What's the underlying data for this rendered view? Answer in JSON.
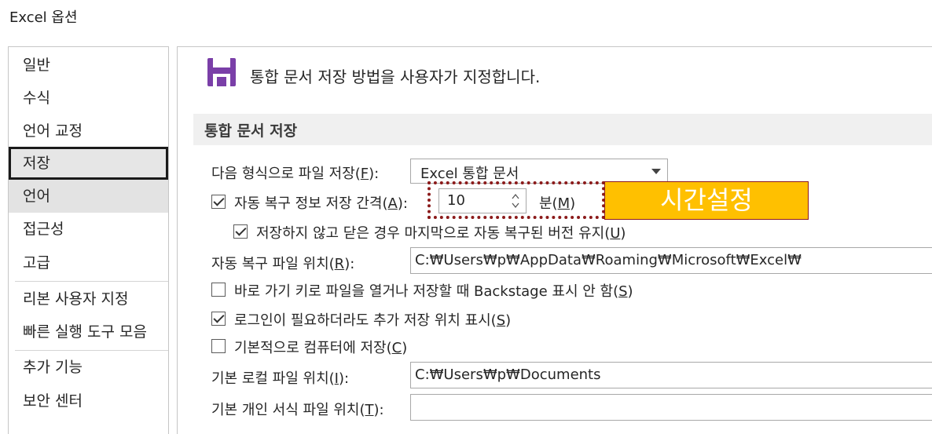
{
  "window": {
    "title": "Excel 옵션"
  },
  "nav": {
    "items": [
      {
        "label": "일반"
      },
      {
        "label": "수식"
      },
      {
        "label": "언어 교정"
      },
      {
        "label": "저장"
      },
      {
        "label": "언어"
      },
      {
        "label": "접근성"
      },
      {
        "label": "고급"
      },
      {
        "label": "리본 사용자 지정"
      },
      {
        "label": "빠른 실행 도구 모음"
      },
      {
        "label": "추가 기능"
      },
      {
        "label": "보안 센터"
      }
    ],
    "selected": "저장"
  },
  "main": {
    "header": "통합 문서 저장 방법을 사용자가 지정합니다.",
    "header_icon": "save-icon",
    "section_title": "통합 문서 저장",
    "save_format": {
      "label": "다음 형식으로 파일 저장(",
      "key": "F",
      "suffix": "):",
      "value": "Excel 통합 문서"
    },
    "autorecover": {
      "label": "자동 복구 정보 저장 간격(",
      "key": "A",
      "suffix": "):",
      "checked": true,
      "value": "10",
      "unit_label": "분(",
      "unit_key": "M",
      "unit_suffix": ")"
    },
    "keep_last": {
      "label": "저장하지 않고 닫은 경우 마지막으로 자동 복구된 버전 유지(",
      "key": "U",
      "suffix": ")",
      "checked": true
    },
    "autorecover_location": {
      "label": "자동 복구 파일 위치(",
      "key": "R",
      "suffix": "):",
      "value": "C:₩Users₩p₩AppData₩Roaming₩Microsoft₩Excel₩"
    },
    "backstage": {
      "label": "바로 가기 키로 파일을 열거나 저장할 때 Backstage 표시 안 함(",
      "key": "S",
      "suffix": ")",
      "checked": false
    },
    "show_extra_locations": {
      "label": "로그인이 필요하더라도 추가 저장 위치 표시(",
      "key": "S",
      "suffix": ")",
      "checked": true
    },
    "save_to_computer": {
      "label": "기본적으로 컴퓨터에 저장(",
      "key": "C",
      "suffix": ")",
      "checked": false
    },
    "default_local_location": {
      "label": "기본 로컬 파일 위치(",
      "key": "I",
      "suffix": "):",
      "value": "C:₩Users₩p₩Documents"
    },
    "personal_templates": {
      "label": "기본 개인 서식 파일 위치(",
      "key": "T",
      "suffix": "):",
      "value": ""
    }
  },
  "annotation": {
    "text": "시간설정",
    "background": "#ffc000",
    "border": "#8b1a1a"
  },
  "colors": {
    "save_icon": "#7a3fa8",
    "selected_border": "#1a1a1a"
  }
}
